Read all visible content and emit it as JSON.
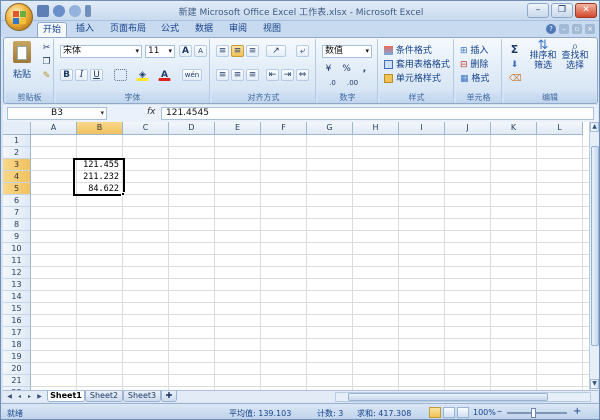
{
  "window": {
    "title": "新建 Microsoft Office Excel 工作表.xlsx - Microsoft Excel",
    "minimize_label": "–",
    "restore_label": "❐",
    "close_label": "✕"
  },
  "tabs": [
    "开始",
    "插入",
    "页面布局",
    "公式",
    "数据",
    "审阅",
    "视图"
  ],
  "ribbon": {
    "clipboard": {
      "label": "剪贴板",
      "paste_label": "粘贴"
    },
    "font": {
      "label": "字体",
      "font_name": "宋体",
      "font_size": "11",
      "bold": "B",
      "italic": "I",
      "underline": "U",
      "grow": "A",
      "shrink": "A",
      "font_color_letter": "A",
      "wen": "wén"
    },
    "alignment": {
      "label": "对齐方式"
    },
    "number": {
      "label": "数字",
      "format": "数值",
      "percent": "%",
      "comma": ","
    },
    "styles": {
      "label": "样式",
      "conditional": "条件格式",
      "table": "套用表格格式",
      "cell": "单元格样式"
    },
    "cells": {
      "label": "单元格",
      "insert": "插入",
      "delete": "删除",
      "format": "格式"
    },
    "editing": {
      "label": "编辑",
      "sum": "Σ",
      "sort_line1": "排序和",
      "sort_line2": "筛选",
      "find_line1": "查找和",
      "find_line2": "选择"
    }
  },
  "formula_bar": {
    "name_box": "B3",
    "fx": "fx",
    "value": "121.4545"
  },
  "columns": [
    "A",
    "B",
    "C",
    "D",
    "E",
    "F",
    "G",
    "H",
    "I",
    "J",
    "K",
    "L"
  ],
  "rows": [
    "1",
    "2",
    "3",
    "4",
    "5",
    "6",
    "7",
    "8",
    "9",
    "10",
    "11",
    "12",
    "13",
    "14",
    "15",
    "16",
    "17",
    "18",
    "19",
    "20",
    "21",
    "22"
  ],
  "cells": {
    "B3": "121.455",
    "B4": "211.232",
    "B5": "84.622"
  },
  "sheets": [
    "Sheet1",
    "Sheet2",
    "Sheet3"
  ],
  "status": {
    "ready": "就绪",
    "average": "平均值: 139.103",
    "count": "计数: 3",
    "sum": "求和: 417.308",
    "zoom": "100%",
    "zoom_minus": "–",
    "zoom_plus": "+"
  },
  "colors": {
    "selection_header": "#f1c15f",
    "grid_line": "#dadcdd",
    "ribbon_bg": "#dbe8f6"
  }
}
